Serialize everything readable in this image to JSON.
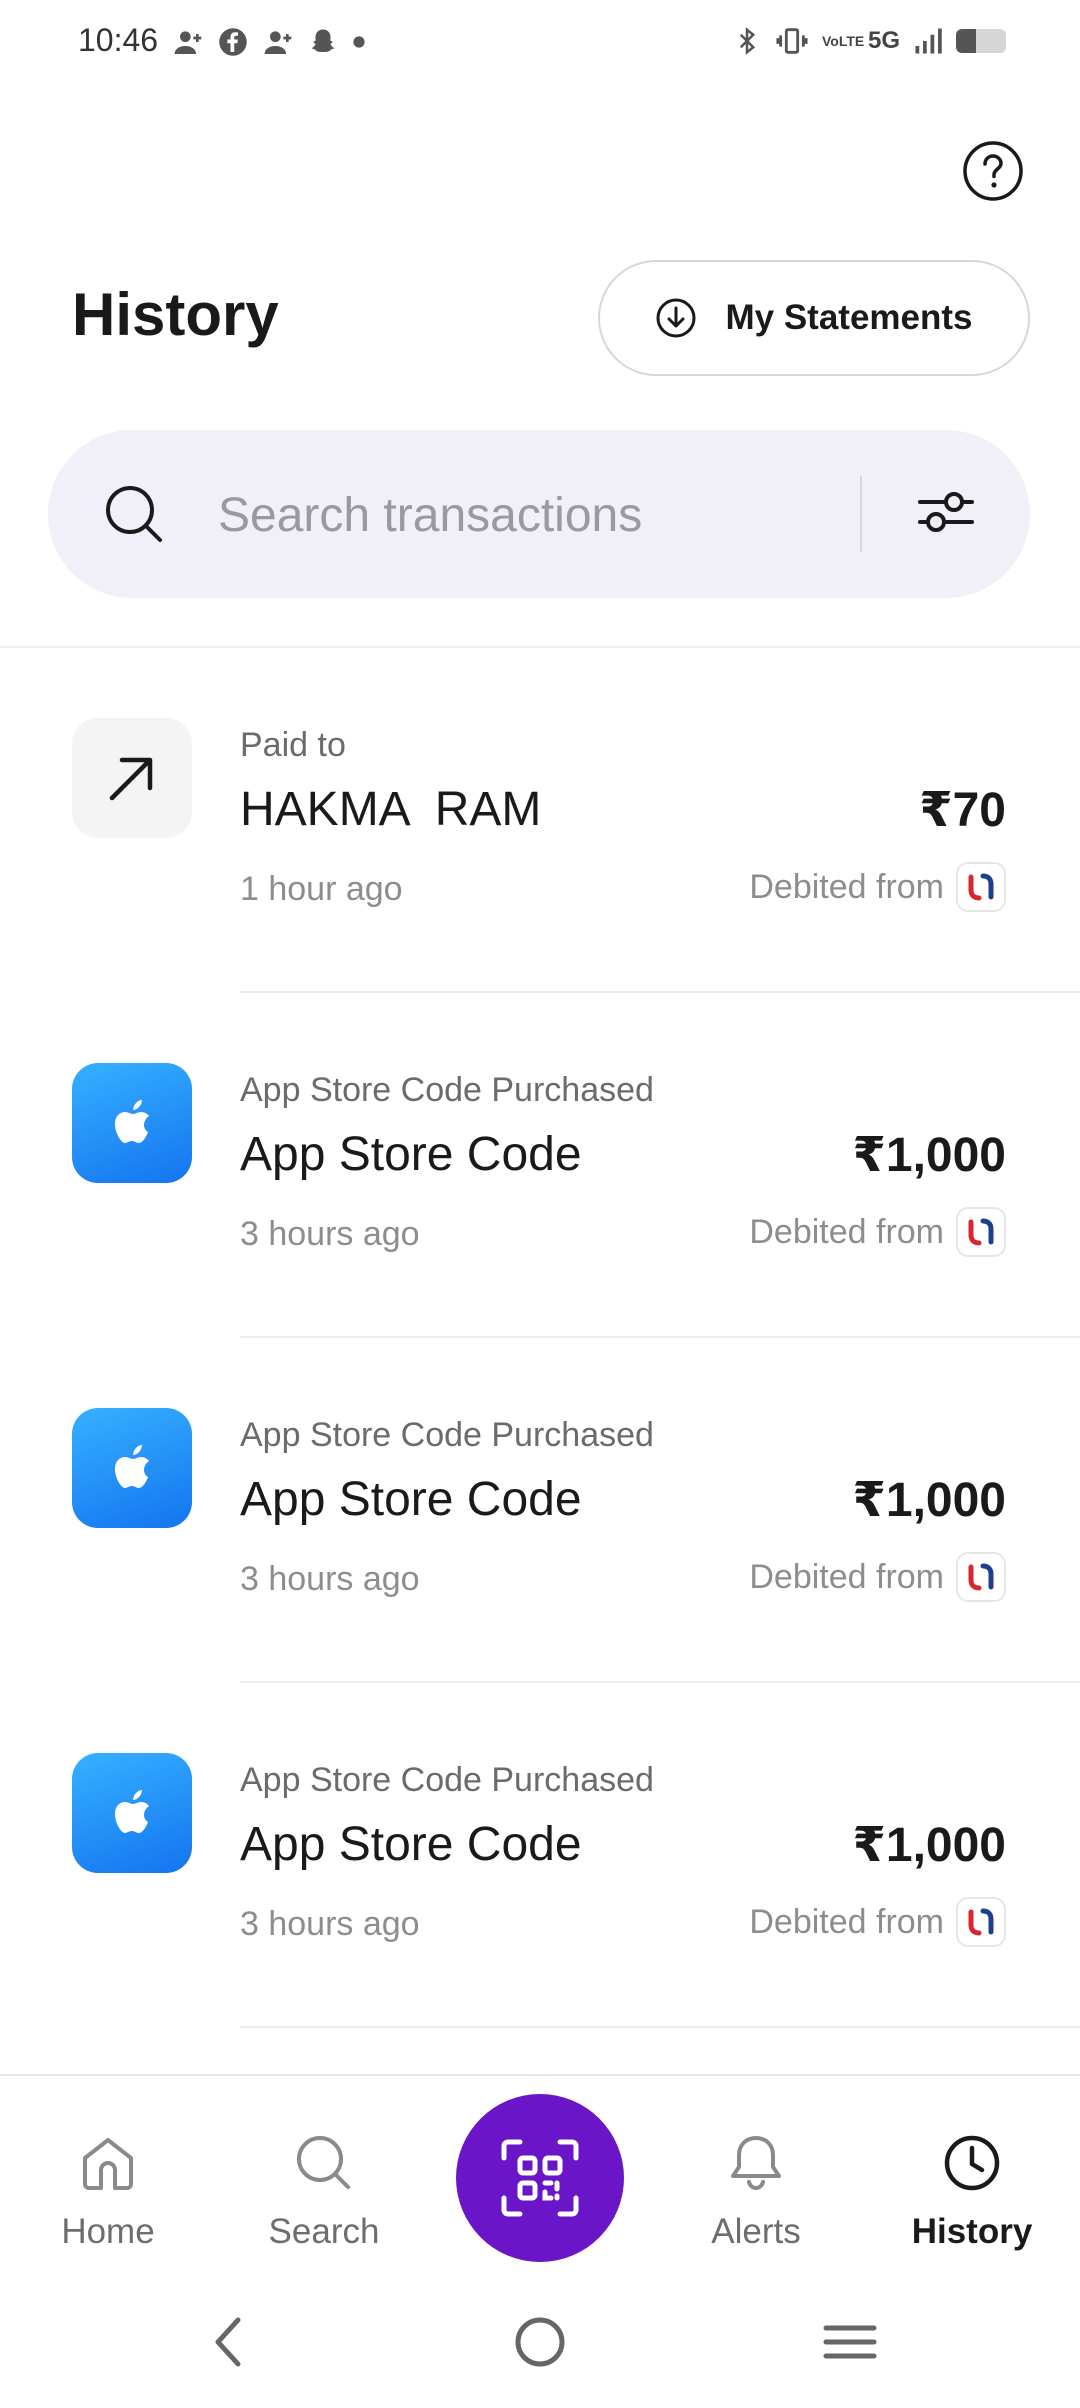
{
  "status_bar": {
    "time": "10:46",
    "network": "5G",
    "volte": "VoLTE",
    "battery_level": 0.4
  },
  "header": {
    "title": "History",
    "statements_label": "My Statements"
  },
  "search": {
    "placeholder": "Search transactions",
    "value": ""
  },
  "transactions": [
    {
      "icon": "arrow-up-right-icon",
      "subtitle": "Paid to",
      "name": "HAKMA  RAM",
      "amount": "₹70",
      "time": "1 hour ago",
      "debit_label": "Debited from"
    },
    {
      "icon": "apple-icon",
      "subtitle": "App Store Code Purchased",
      "name": "App Store Code",
      "amount": "₹1,000",
      "time": "3 hours ago",
      "debit_label": "Debited from"
    },
    {
      "icon": "apple-icon",
      "subtitle": "App Store Code Purchased",
      "name": "App Store Code",
      "amount": "₹1,000",
      "time": "3 hours ago",
      "debit_label": "Debited from"
    },
    {
      "icon": "apple-icon",
      "subtitle": "App Store Code Purchased",
      "name": "App Store Code",
      "amount": "₹1,000",
      "time": "3 hours ago",
      "debit_label": "Debited from"
    }
  ],
  "bottom_nav": {
    "home": "Home",
    "search": "Search",
    "alerts": "Alerts",
    "history": "History",
    "active": "history"
  },
  "colors": {
    "accent": "#6a15c8",
    "search_bg": "#f1eff8",
    "apple_blue": "#1474f0"
  }
}
